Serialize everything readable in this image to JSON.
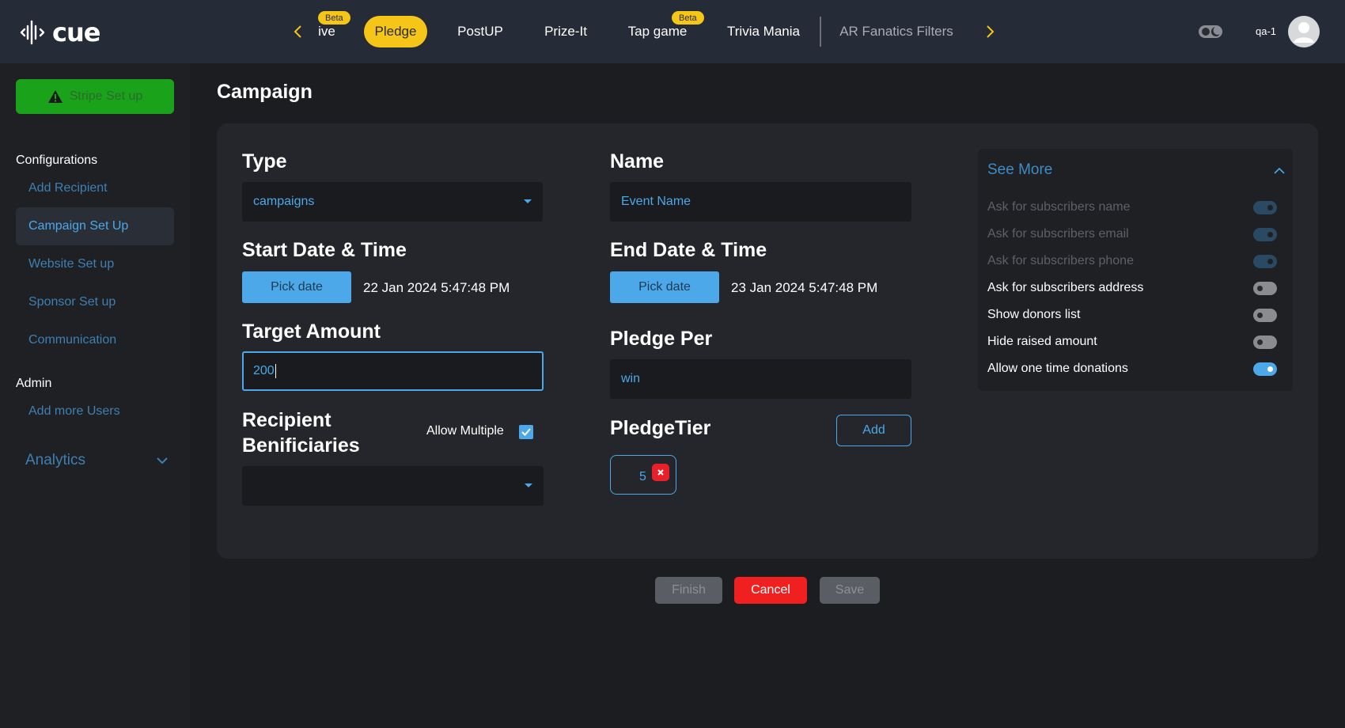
{
  "app": {
    "logo_text": "cue",
    "user_name": "qa-1"
  },
  "nav": {
    "tabs": [
      {
        "label": "ive",
        "beta": "Beta"
      },
      {
        "label": "Pledge"
      },
      {
        "label": "PostUP"
      },
      {
        "label": "Prize-It"
      },
      {
        "label": "Tap game",
        "beta": "Beta"
      },
      {
        "label": "Trivia Mania"
      },
      {
        "label": "AR Fanatics Filters"
      }
    ],
    "active_tab": "Pledge"
  },
  "sidebar": {
    "stripe_button": "Stripe Set up",
    "configurations_heading": "Configurations",
    "config_items": [
      {
        "label": "Add Recipient"
      },
      {
        "label": "Campaign Set Up"
      },
      {
        "label": "Website Set up"
      },
      {
        "label": "Sponsor Set up"
      },
      {
        "label": "Communication"
      }
    ],
    "admin_heading": "Admin",
    "admin_items": [
      {
        "label": "Add more Users"
      }
    ],
    "analytics_label": "Analytics"
  },
  "main": {
    "title": "Campaign",
    "type": {
      "label": "Type",
      "value": "campaigns"
    },
    "name": {
      "label": "Name",
      "placeholder": "Event Name"
    },
    "start": {
      "label": "Start Date & Time",
      "button": "Pick date",
      "value": "22 Jan 2024 5:47:48 PM"
    },
    "end": {
      "label": "End Date & Time",
      "button": "Pick date",
      "value": "23 Jan 2024 5:47:48 PM"
    },
    "target": {
      "label": "Target Amount",
      "value": "200"
    },
    "pledge_per": {
      "label": "Pledge Per",
      "value": "win"
    },
    "recipients": {
      "label_line1": "Recipient",
      "label_line2": "Benificiaries",
      "allow_multiple": "Allow Multiple",
      "allow_multiple_checked": true
    },
    "pledge_tier": {
      "label": "PledgeTier",
      "add_button": "Add",
      "tiers": [
        "5"
      ]
    }
  },
  "see_more": {
    "title": "See More",
    "options": [
      {
        "label": "Ask for subscribers name",
        "state": "on",
        "disabled": true
      },
      {
        "label": "Ask for subscribers email",
        "state": "on",
        "disabled": true
      },
      {
        "label": "Ask for subscribers phone",
        "state": "on",
        "disabled": true
      },
      {
        "label": "Ask for subscribers address",
        "state": "off",
        "disabled": false
      },
      {
        "label": "Show donors list",
        "state": "off",
        "disabled": false
      },
      {
        "label": "Hide raised amount",
        "state": "off",
        "disabled": false
      },
      {
        "label": "Allow one time donations",
        "state": "on",
        "disabled": false
      }
    ]
  },
  "footer": {
    "finish": "Finish",
    "cancel": "Cancel",
    "save": "Save"
  },
  "colors": {
    "accent": "#4ca8e8",
    "pill_active": "#f5c518",
    "stripe_green": "#1aa31a",
    "cancel_red": "#f02020",
    "topbar": "#262b38"
  }
}
